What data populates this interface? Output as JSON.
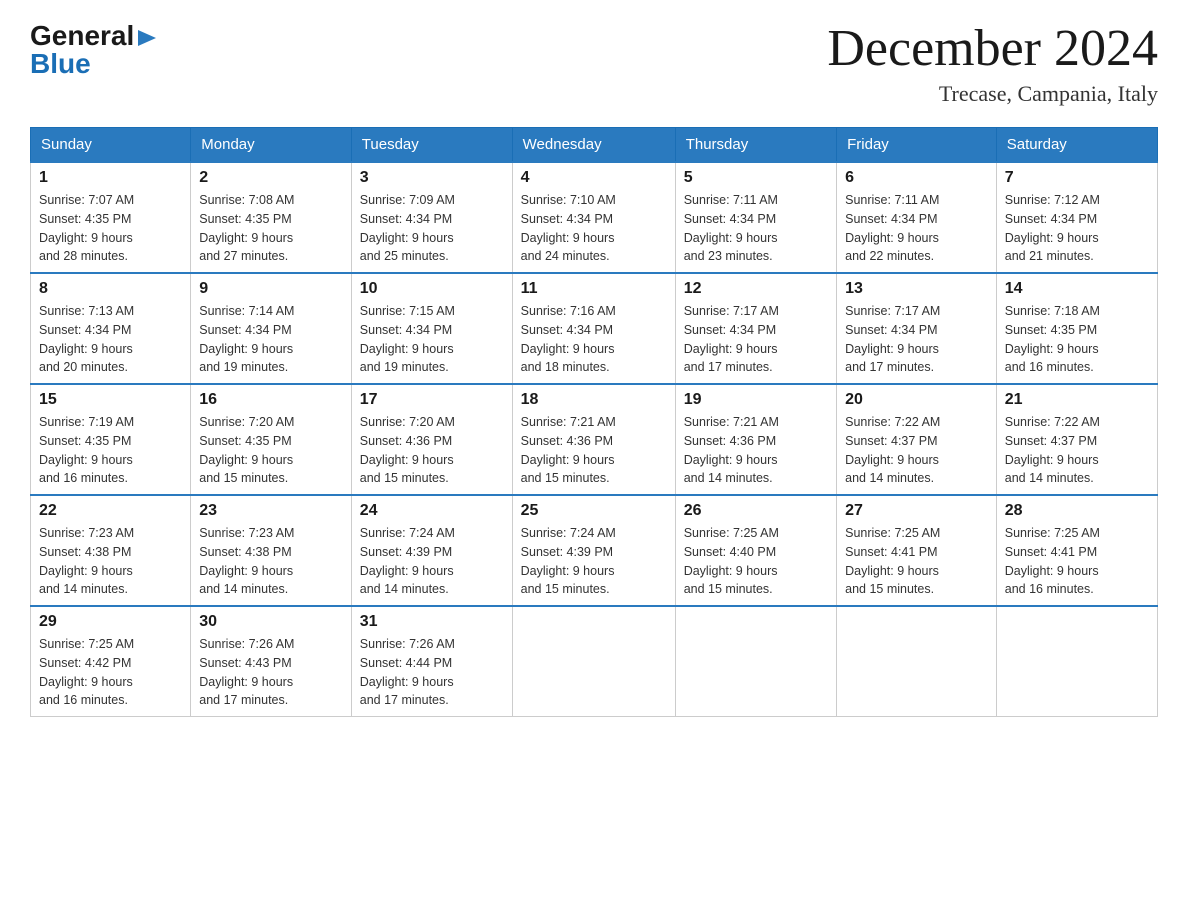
{
  "header": {
    "logo_line1": "General",
    "logo_arrow": "▶",
    "logo_line2": "Blue",
    "month_title": "December 2024",
    "location": "Trecase, Campania, Italy"
  },
  "days_of_week": [
    "Sunday",
    "Monday",
    "Tuesday",
    "Wednesday",
    "Thursday",
    "Friday",
    "Saturday"
  ],
  "weeks": [
    [
      {
        "day": "1",
        "sunrise": "7:07 AM",
        "sunset": "4:35 PM",
        "daylight": "9 hours and 28 minutes."
      },
      {
        "day": "2",
        "sunrise": "7:08 AM",
        "sunset": "4:35 PM",
        "daylight": "9 hours and 27 minutes."
      },
      {
        "day": "3",
        "sunrise": "7:09 AM",
        "sunset": "4:34 PM",
        "daylight": "9 hours and 25 minutes."
      },
      {
        "day": "4",
        "sunrise": "7:10 AM",
        "sunset": "4:34 PM",
        "daylight": "9 hours and 24 minutes."
      },
      {
        "day": "5",
        "sunrise": "7:11 AM",
        "sunset": "4:34 PM",
        "daylight": "9 hours and 23 minutes."
      },
      {
        "day": "6",
        "sunrise": "7:11 AM",
        "sunset": "4:34 PM",
        "daylight": "9 hours and 22 minutes."
      },
      {
        "day": "7",
        "sunrise": "7:12 AM",
        "sunset": "4:34 PM",
        "daylight": "9 hours and 21 minutes."
      }
    ],
    [
      {
        "day": "8",
        "sunrise": "7:13 AM",
        "sunset": "4:34 PM",
        "daylight": "9 hours and 20 minutes."
      },
      {
        "day": "9",
        "sunrise": "7:14 AM",
        "sunset": "4:34 PM",
        "daylight": "9 hours and 19 minutes."
      },
      {
        "day": "10",
        "sunrise": "7:15 AM",
        "sunset": "4:34 PM",
        "daylight": "9 hours and 19 minutes."
      },
      {
        "day": "11",
        "sunrise": "7:16 AM",
        "sunset": "4:34 PM",
        "daylight": "9 hours and 18 minutes."
      },
      {
        "day": "12",
        "sunrise": "7:17 AM",
        "sunset": "4:34 PM",
        "daylight": "9 hours and 17 minutes."
      },
      {
        "day": "13",
        "sunrise": "7:17 AM",
        "sunset": "4:34 PM",
        "daylight": "9 hours and 17 minutes."
      },
      {
        "day": "14",
        "sunrise": "7:18 AM",
        "sunset": "4:35 PM",
        "daylight": "9 hours and 16 minutes."
      }
    ],
    [
      {
        "day": "15",
        "sunrise": "7:19 AM",
        "sunset": "4:35 PM",
        "daylight": "9 hours and 16 minutes."
      },
      {
        "day": "16",
        "sunrise": "7:20 AM",
        "sunset": "4:35 PM",
        "daylight": "9 hours and 15 minutes."
      },
      {
        "day": "17",
        "sunrise": "7:20 AM",
        "sunset": "4:36 PM",
        "daylight": "9 hours and 15 minutes."
      },
      {
        "day": "18",
        "sunrise": "7:21 AM",
        "sunset": "4:36 PM",
        "daylight": "9 hours and 15 minutes."
      },
      {
        "day": "19",
        "sunrise": "7:21 AM",
        "sunset": "4:36 PM",
        "daylight": "9 hours and 14 minutes."
      },
      {
        "day": "20",
        "sunrise": "7:22 AM",
        "sunset": "4:37 PM",
        "daylight": "9 hours and 14 minutes."
      },
      {
        "day": "21",
        "sunrise": "7:22 AM",
        "sunset": "4:37 PM",
        "daylight": "9 hours and 14 minutes."
      }
    ],
    [
      {
        "day": "22",
        "sunrise": "7:23 AM",
        "sunset": "4:38 PM",
        "daylight": "9 hours and 14 minutes."
      },
      {
        "day": "23",
        "sunrise": "7:23 AM",
        "sunset": "4:38 PM",
        "daylight": "9 hours and 14 minutes."
      },
      {
        "day": "24",
        "sunrise": "7:24 AM",
        "sunset": "4:39 PM",
        "daylight": "9 hours and 14 minutes."
      },
      {
        "day": "25",
        "sunrise": "7:24 AM",
        "sunset": "4:39 PM",
        "daylight": "9 hours and 15 minutes."
      },
      {
        "day": "26",
        "sunrise": "7:25 AM",
        "sunset": "4:40 PM",
        "daylight": "9 hours and 15 minutes."
      },
      {
        "day": "27",
        "sunrise": "7:25 AM",
        "sunset": "4:41 PM",
        "daylight": "9 hours and 15 minutes."
      },
      {
        "day": "28",
        "sunrise": "7:25 AM",
        "sunset": "4:41 PM",
        "daylight": "9 hours and 16 minutes."
      }
    ],
    [
      {
        "day": "29",
        "sunrise": "7:25 AM",
        "sunset": "4:42 PM",
        "daylight": "9 hours and 16 minutes."
      },
      {
        "day": "30",
        "sunrise": "7:26 AM",
        "sunset": "4:43 PM",
        "daylight": "9 hours and 17 minutes."
      },
      {
        "day": "31",
        "sunrise": "7:26 AM",
        "sunset": "4:44 PM",
        "daylight": "9 hours and 17 minutes."
      },
      null,
      null,
      null,
      null
    ]
  ],
  "labels": {
    "sunrise": "Sunrise:",
    "sunset": "Sunset:",
    "daylight": "Daylight:"
  }
}
